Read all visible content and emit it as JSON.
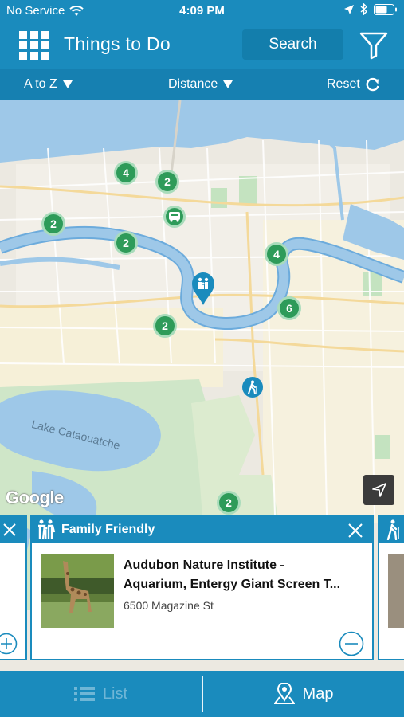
{
  "status_bar": {
    "carrier": "No Service",
    "time": "4:09 PM"
  },
  "header": {
    "title": "Things to Do",
    "search_label": "Search",
    "menu_icon": "grid-icon",
    "filter_icon": "filter-icon"
  },
  "sort_bar": {
    "sort_label": "A to Z",
    "distance_label": "Distance",
    "reset_label": "Reset"
  },
  "map": {
    "label_lake": "Lake Cataouatche",
    "google_label": "Google",
    "clusters": [
      "4",
      "2",
      "2",
      "2",
      "4",
      "6",
      "2",
      "2"
    ],
    "pins": [
      "family-friendly-pin",
      "bus-pin",
      "hiking-pin"
    ]
  },
  "cards": {
    "category": "Family Friendly",
    "title": "Audubon Nature Institute -\nAquarium, Entergy Giant Screen T...",
    "address": "6500 Magazine St"
  },
  "tab_bar": {
    "list_label": "List",
    "map_label": "Map"
  },
  "colors": {
    "primary": "#1a8bbd",
    "cluster_green": "#2e9b59",
    "water": "#9ec8e8"
  }
}
